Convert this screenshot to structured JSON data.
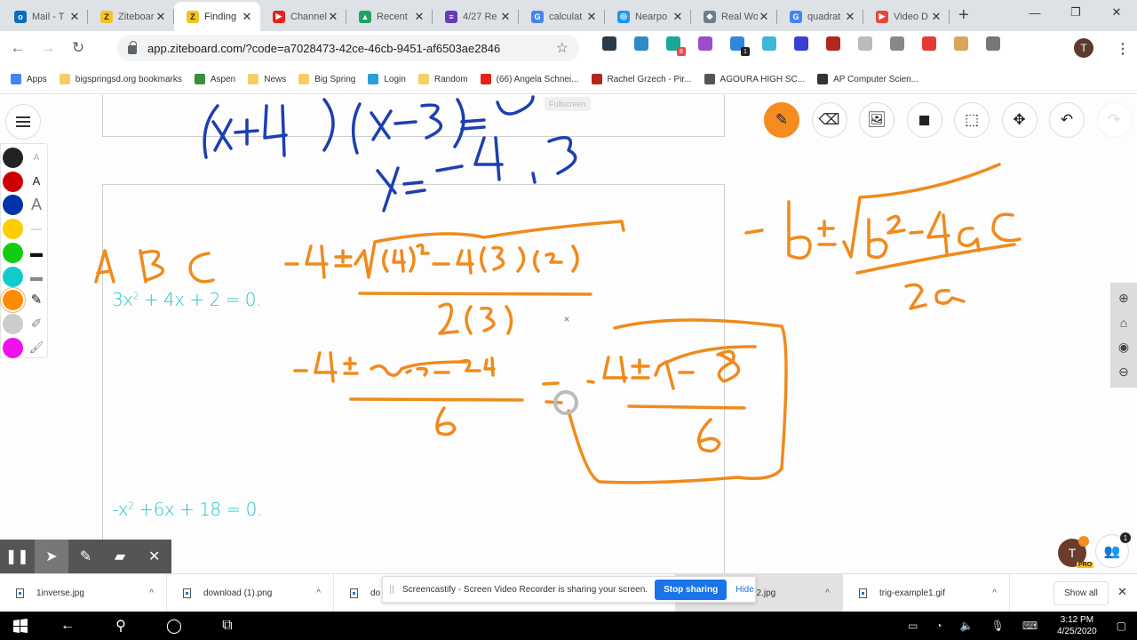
{
  "browser": {
    "tabs": [
      {
        "label": "Mail - T",
        "icon": "outlook-icon",
        "color": "#0f6cbd",
        "glyph": "o"
      },
      {
        "label": "Ziteboar",
        "icon": "ziteboard-icon",
        "color": "#f3c324",
        "glyph": "Z"
      },
      {
        "label": "Finding",
        "icon": "ziteboard-icon",
        "color": "#f3c324",
        "glyph": "Z",
        "active": true
      },
      {
        "label": "Channel",
        "icon": "youtube-icon",
        "color": "#e62117",
        "glyph": "▶"
      },
      {
        "label": "Recent",
        "icon": "drive-icon",
        "color": "#1fa463",
        "glyph": "▲"
      },
      {
        "label": "4/27 Re",
        "icon": "forms-icon",
        "color": "#673ab7",
        "glyph": "≡"
      },
      {
        "label": "calculat",
        "icon": "google-icon",
        "color": "#4285f4",
        "glyph": "G"
      },
      {
        "label": "Nearpo",
        "icon": "nearpod-icon",
        "color": "#2196f3",
        "glyph": "◎"
      },
      {
        "label": "Real Wo",
        "icon": "realworld-icon",
        "color": "#6a7f8a",
        "glyph": "◆"
      },
      {
        "label": "quadrat",
        "icon": "google-icon",
        "color": "#4285f4",
        "glyph": "G"
      },
      {
        "label": "Video D",
        "icon": "video-icon",
        "color": "#e8453c",
        "glyph": "▶"
      }
    ],
    "new_tab": "+",
    "window_controls": {
      "minimize": "—",
      "maximize": "❐",
      "close": "✕"
    },
    "url": "app.ziteboard.com/?code=a7028473-42ce-46cb-9451-af6503ae2846",
    "profile_initial": "T",
    "extensions": [
      {
        "name": "ext-dark-icon",
        "color": "#2b3a4a"
      },
      {
        "name": "ext-edge-icon",
        "color": "#2e8cc4"
      },
      {
        "name": "ext-a-icon",
        "color": "#1aa898",
        "badge": "8",
        "badge_color": "#e54b4b"
      },
      {
        "name": "ext-puzzle-icon",
        "color": "#9c4dcc"
      },
      {
        "name": "ext-ghost-icon",
        "color": "#2e88e0",
        "badge": "1",
        "badge_color": "#222"
      },
      {
        "name": "ext-tldr-icon",
        "color": "#3fb6d8"
      },
      {
        "name": "ext-c-icon",
        "color": "#3a3fd1"
      },
      {
        "name": "ext-pdf-icon",
        "color": "#b3261e"
      },
      {
        "name": "ext-gray-icon",
        "color": "#bbbbbb"
      },
      {
        "name": "ext-apple-icon",
        "color": "#888888"
      },
      {
        "name": "ext-record-icon",
        "color": "#e53935"
      },
      {
        "name": "ext-palette-icon",
        "color": "#d6a65c"
      },
      {
        "name": "ext-grid-icon",
        "color": "#777777"
      }
    ],
    "bookmarks": [
      {
        "label": "Apps",
        "icon": "apps-grid-icon",
        "color": "#4285f4"
      },
      {
        "label": "bigspringsd.org bookmarks",
        "icon": "folder-icon",
        "color": "#f5cf66"
      },
      {
        "label": "Aspen",
        "icon": "aspen-icon",
        "color": "#3a8f3a"
      },
      {
        "label": "News",
        "icon": "folder-icon",
        "color": "#f5cf66"
      },
      {
        "label": "Big Spring",
        "icon": "folder-icon",
        "color": "#f5cf66"
      },
      {
        "label": "Login",
        "icon": "login-icon",
        "color": "#2aa0d8"
      },
      {
        "label": "Random",
        "icon": "folder-icon",
        "color": "#f5cf66"
      },
      {
        "label": "(66) Angela Schnei...",
        "icon": "youtube-icon",
        "color": "#e62117"
      },
      {
        "label": "Rachel Grzech - Pir...",
        "icon": "r-icon",
        "color": "#b3261e"
      },
      {
        "label": "AGOURA HIGH SC...",
        "icon": "globe-icon",
        "color": "#555555"
      },
      {
        "label": "AP Computer Scien...",
        "icon": "acorn-icon",
        "color": "#333333"
      }
    ]
  },
  "whiteboard": {
    "fullscreen_label": "Fullscreen",
    "palette": {
      "colors": [
        "#222222",
        "#cc0000",
        "#0033a6",
        "#ffcc00",
        "#11cc11",
        "#11cccc",
        "#ff8c00",
        "#cccccc",
        "#ee11ee"
      ],
      "selected_color": "#ff8c00",
      "tools": [
        "text-small-icon",
        "text-medium-icon",
        "text-large-icon",
        "line-thin-icon",
        "line-medium-icon",
        "line-thick-icon",
        "pen-icon",
        "highlighter-icon",
        "roller-icon"
      ]
    },
    "toolbar": [
      {
        "name": "pen-tool-button",
        "icon": "pencil-icon",
        "glyph": "✎",
        "active": true
      },
      {
        "name": "eraser-tool-button",
        "icon": "eraser-icon",
        "glyph": "⌫"
      },
      {
        "name": "image-tool-button",
        "icon": "image-icon",
        "glyph": "🖼"
      },
      {
        "name": "sticky-note-button",
        "icon": "sticky-note-icon",
        "glyph": "◼"
      },
      {
        "name": "select-area-button",
        "icon": "select-area-icon",
        "glyph": "⬚"
      },
      {
        "name": "pan-tool-button",
        "icon": "move-icon",
        "glyph": "✥"
      },
      {
        "name": "undo-button",
        "icon": "undo-icon",
        "glyph": "↶"
      },
      {
        "name": "redo-button",
        "icon": "redo-icon",
        "glyph": "↷",
        "disabled": true
      }
    ],
    "zoom_controls": {
      "zoom_in": "⊕",
      "home": "⌂",
      "center": "◉",
      "zoom_out": "⊖"
    },
    "typed_equations": [
      {
        "base": "3x",
        "exp": "2",
        "rest": " + 4x + 2 = 0."
      },
      {
        "base": "-x",
        "exp": "2",
        "rest": " +6x + 18 = 0."
      }
    ],
    "handwriting": {
      "blue": [
        "(x+4)(x-3)=0",
        "x = -4, 3"
      ],
      "orange": [
        "A B C",
        "-4 ± √((4)² - 4(3)(2)) / 2(3)",
        "-4 ± √(16 - 24) / 6",
        "= -4 ± √(-8) / 6",
        "-b ± √(b² - 4ac) / 2a"
      ]
    },
    "user": {
      "initial": "T",
      "badge": "PRO",
      "participants_count": "1"
    }
  },
  "screencastify_toolbar": {
    "buttons": [
      "pause-icon",
      "cursor-icon",
      "pen-icon",
      "eraser-icon",
      "close-icon"
    ],
    "glyphs": [
      "❚❚",
      "➤",
      "✎",
      "▰",
      "✕"
    ]
  },
  "downloads": {
    "items": [
      "1inverse.jpg",
      "download (1).png",
      "do",
      "e2.jpg",
      "trig-example1.gif"
    ],
    "show_all": "Show all",
    "close": "✕"
  },
  "share_notice": {
    "text": "Screencastify - Screen Video Recorder is sharing your screen.",
    "stop_label": "Stop sharing",
    "hide_label": "Hide"
  },
  "taskbar": {
    "time": "3:12 PM",
    "date": "4/25/2020"
  }
}
